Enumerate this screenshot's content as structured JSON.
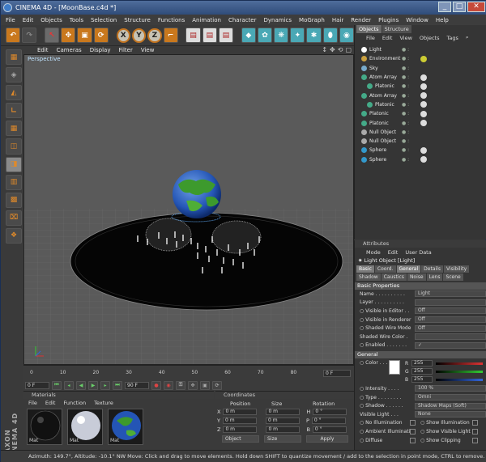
{
  "window": {
    "title": "CINEMA 4D - [MoonBase.c4d *]"
  },
  "menu": [
    "File",
    "Edit",
    "Objects",
    "Tools",
    "Selection",
    "Structure",
    "Functions",
    "Animation",
    "Character",
    "Dynamics",
    "MoGraph",
    "Hair",
    "Render",
    "Plugins",
    "Window",
    "Help"
  ],
  "toolbar": {
    "axis_x": "X",
    "axis_y": "Y",
    "axis_z": "Z"
  },
  "viewport": {
    "menu": [
      "Edit",
      "Cameras",
      "Display",
      "Filter",
      "View"
    ],
    "label": "Perspective",
    "controls": [
      "↕",
      "✥",
      "⟲",
      "▢"
    ]
  },
  "timeline": {
    "ticks": [
      "0",
      "10",
      "20",
      "30",
      "40",
      "50",
      "60",
      "70",
      "80",
      "90"
    ],
    "end_field": "0 F",
    "current_field": "0 F",
    "frame_field": "90 F"
  },
  "materials": {
    "title": "Materials",
    "menu": [
      "File",
      "Edit",
      "Function",
      "Texture"
    ],
    "items": [
      {
        "name": "Mat"
      },
      {
        "name": "Mat"
      },
      {
        "name": "Mat"
      }
    ]
  },
  "coordinates": {
    "title": "Coordinates",
    "headers": [
      "Position",
      "Size",
      "Rotation"
    ],
    "rows": [
      {
        "axis": "X",
        "pos": "0 m",
        "size": "0 m",
        "rot_axis": "H",
        "rot": "0 °"
      },
      {
        "axis": "Y",
        "pos": "0 m",
        "size": "0 m",
        "rot_axis": "P",
        "rot": "0 °"
      },
      {
        "axis": "Z",
        "pos": "0 m",
        "size": "0 m",
        "rot_axis": "B",
        "rot": "0 °"
      }
    ],
    "mode": "Object",
    "size_mode": "Size",
    "apply": "Apply"
  },
  "status": "Azimuth: 149.7°, Altitude: -10.1°  NW   Move: Click and drag to move elements. Hold down SHIFT to quantize movement / add to the selection in point mode, CTRL to remove.",
  "objects_panel": {
    "tabs": [
      "Objects",
      "Structure"
    ],
    "menu": [
      "File",
      "Edit",
      "View",
      "Objects",
      "Tags"
    ],
    "items": [
      {
        "name": "Light",
        "indent": 0
      },
      {
        "name": "Environment",
        "indent": 0
      },
      {
        "name": "Sky",
        "indent": 0
      },
      {
        "name": "Atom Array",
        "indent": 0
      },
      {
        "name": "Platonic",
        "indent": 1
      },
      {
        "name": "Atom Array",
        "indent": 0
      },
      {
        "name": "Platonic",
        "indent": 1
      },
      {
        "name": "Platonic",
        "indent": 0
      },
      {
        "name": "Platonic",
        "indent": 0
      },
      {
        "name": "Null Object",
        "indent": 0
      },
      {
        "name": "Null Object",
        "indent": 0
      },
      {
        "name": "Sphere",
        "indent": 0
      },
      {
        "name": "Sphere",
        "indent": 0
      }
    ]
  },
  "attributes": {
    "title": "Attributes",
    "menu": [
      "Mode",
      "Edit",
      "User Data"
    ],
    "object_label": "Light Object [Light]",
    "tabs": [
      {
        "label": "Basic",
        "on": true
      },
      {
        "label": "Coord.",
        "on": false
      },
      {
        "label": "General",
        "on": true
      },
      {
        "label": "Details",
        "on": false
      },
      {
        "label": "Visibility",
        "on": false
      },
      {
        "label": "Shadow",
        "on": false
      },
      {
        "label": "Caustics",
        "on": false
      },
      {
        "label": "Noise",
        "on": false
      },
      {
        "label": "Lens",
        "on": false
      },
      {
        "label": "Scene",
        "on": false
      }
    ],
    "basic_title": "Basic Properties",
    "basic": [
      {
        "label": "Name . . . . . . . . . .",
        "value": "Light"
      },
      {
        "label": "Layer . . . . . . . . . .",
        "value": ""
      },
      {
        "label": "○ Visible in Editor . .",
        "value": "Off"
      },
      {
        "label": "○ Visible in Renderer",
        "value": "Off"
      },
      {
        "label": "○ Shaded Wire Mode",
        "value": "Off"
      },
      {
        "label": "Shaded Wire Color .",
        "value": ""
      },
      {
        "label": "○ Enabled . . . . . . .",
        "value": "✓"
      }
    ],
    "general_title": "General",
    "color_label": "○ Color . . . . . . .",
    "rgb": [
      {
        "ch": "R",
        "val": "255"
      },
      {
        "ch": "G",
        "val": "255"
      },
      {
        "ch": "B",
        "val": "255"
      }
    ],
    "general": [
      {
        "label": "○ Intensity . . . .",
        "value": "100 %"
      },
      {
        "label": "○ Type . . . . . . . .",
        "value": "Omni"
      },
      {
        "label": "○ Shadow . . . . . .",
        "value": "Shadow Maps (Soft)"
      },
      {
        "label": "Visible Light . . .",
        "value": "None"
      }
    ],
    "flags": [
      {
        "left": "○ No Illumination",
        "right": "○ Show Illumination"
      },
      {
        "left": "○ Ambient Illumination",
        "right": "○ Show Visible Light"
      },
      {
        "left": "○ Diffuse",
        "right": "○ Show Clipping"
      }
    ]
  },
  "colors": {
    "accent": "#c9781d",
    "selection": "#4aa8b5"
  }
}
